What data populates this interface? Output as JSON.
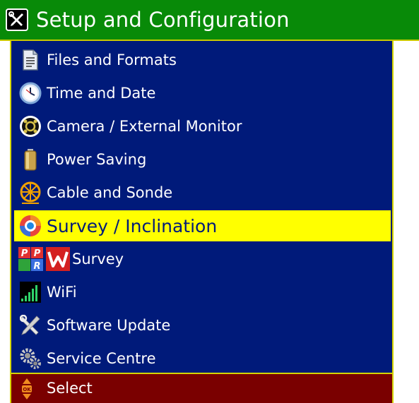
{
  "title": "Setup and Configuration",
  "menu": {
    "items": [
      {
        "label": "Files and Formats",
        "icon": "document-icon"
      },
      {
        "label": "Time and Date",
        "icon": "clock-icon"
      },
      {
        "label": "Camera / External Monitor",
        "icon": "camera-icon"
      },
      {
        "label": "Power Saving",
        "icon": "battery-icon"
      },
      {
        "label": "Cable and Sonde",
        "icon": "cable-reel-icon"
      },
      {
        "label": "Survey / Inclination",
        "icon": "inclination-icon",
        "selected": true
      },
      {
        "label": "Survey",
        "icon": "ppr-logo-icon",
        "secondary_icon": "w-logo-icon"
      },
      {
        "label": "WiFi",
        "icon": "wifi-signal-icon"
      },
      {
        "label": "Software Update",
        "icon": "tools-icon"
      },
      {
        "label": "Service Centre",
        "icon": "gears-icon"
      }
    ]
  },
  "footer": {
    "select_label": "Select",
    "icon": "ok-updown-icon"
  },
  "colors": {
    "title_bar": "#088a08",
    "menu_background": "#001a7a",
    "selected_background": "#ffff00",
    "footer_background": "#7a0000",
    "border": "#d6d600"
  }
}
